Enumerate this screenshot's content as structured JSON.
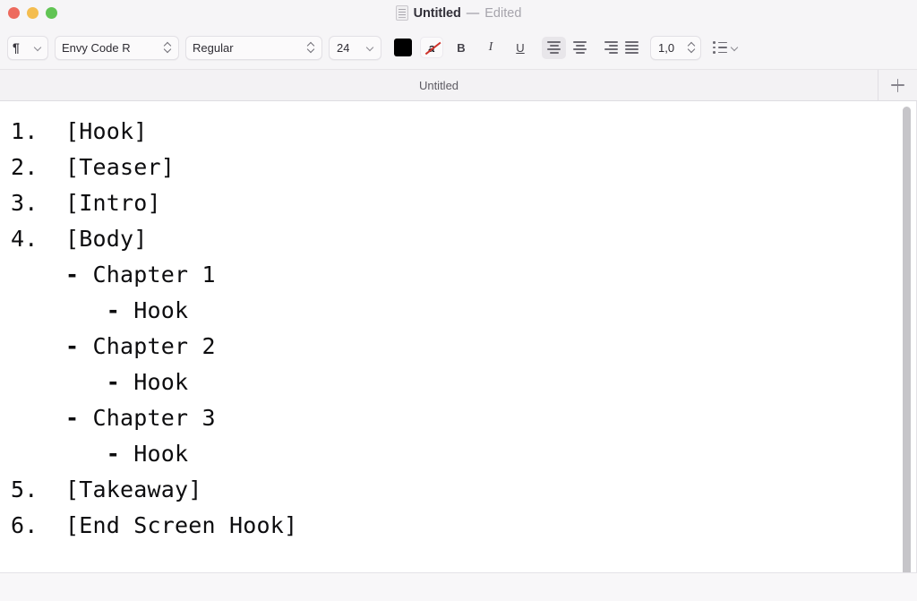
{
  "window": {
    "title": "Untitled",
    "separator": "—",
    "state": "Edited",
    "traffic_lights": [
      {
        "name": "close",
        "color": "#ed6a5e"
      },
      {
        "name": "minimize",
        "color": "#f4bd4f"
      },
      {
        "name": "zoom",
        "color": "#61c454"
      }
    ]
  },
  "toolbar": {
    "paragraph_style": "¶",
    "font_family": "Envy Code R",
    "font_style": "Regular",
    "font_size": "24",
    "text_color": "#000000",
    "highlight_label": "a",
    "bold_label": "B",
    "italic_label": "I",
    "underline_label": "U",
    "align_active": "left",
    "line_spacing": "1,0",
    "list_label": ""
  },
  "tabbar": {
    "tab_label": "Untitled",
    "new_tab_label": "+"
  },
  "document": {
    "lines": [
      "1.  [Hook]",
      "2.  [Teaser]",
      "3.  [Intro]",
      "4.  [Body]",
      "    - Chapter 1",
      "       - Hook",
      "    - Chapter 2",
      "       - Hook",
      "    - Chapter 3",
      "       - Hook",
      "5.  [Takeaway]",
      "6.  [End Screen Hook]"
    ]
  }
}
